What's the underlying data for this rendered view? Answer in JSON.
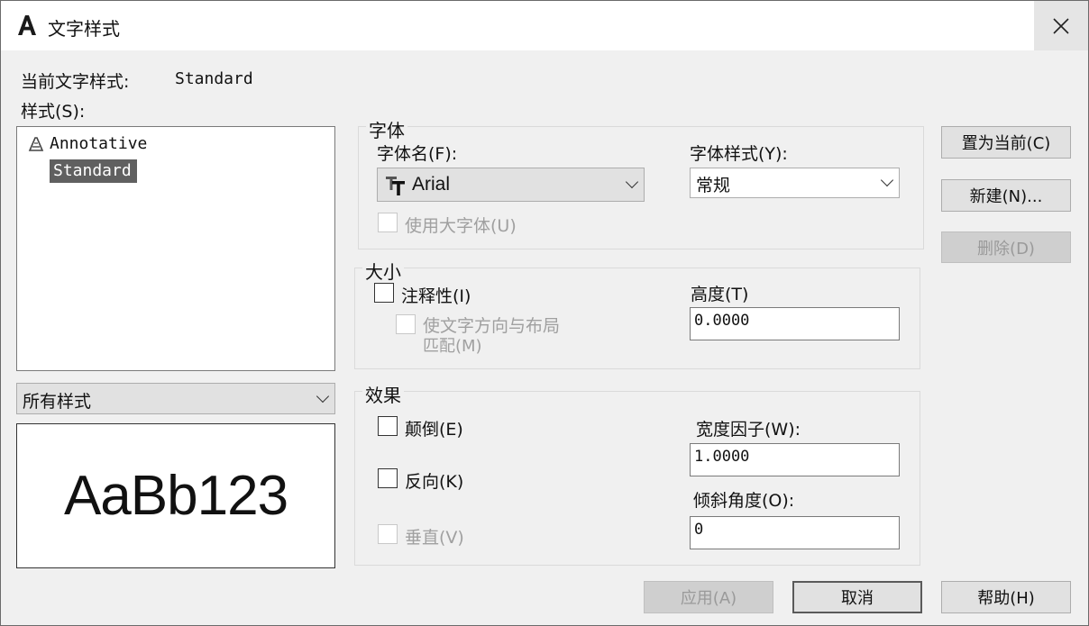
{
  "window": {
    "title": "文字样式",
    "close_symbol": "✕"
  },
  "current_style": {
    "label": "当前文字样式:",
    "value": "Standard"
  },
  "styles": {
    "label": "样式(S):",
    "items": [
      {
        "name": "Annotative",
        "annotative": true
      },
      {
        "name": "Standard",
        "selected": true
      }
    ],
    "filter": "所有样式"
  },
  "preview": {
    "text": "AaBb123"
  },
  "font_group": {
    "legend": "字体",
    "font_name_label": "字体名(F):",
    "font_name_value": "Arial",
    "font_style_label": "字体样式(Y):",
    "font_style_value": "常规",
    "big_font_label": "使用大字体(U)"
  },
  "size_group": {
    "legend": "大小",
    "annotative_label": "注释性(I)",
    "match_orientation_label_1": "使文字方向与布局",
    "match_orientation_label_2": "匹配(M)",
    "height_label": "高度(T)",
    "height_value": "0.0000"
  },
  "effects_group": {
    "legend": "效果",
    "upside_down_label": "颠倒(E)",
    "backwards_label": "反向(K)",
    "vertical_label": "垂直(V)",
    "width_factor_label": "宽度因子(W):",
    "width_factor_value": "1.0000",
    "oblique_angle_label": "倾斜角度(O):",
    "oblique_angle_value": "0"
  },
  "buttons": {
    "set_current": "置为当前(C)",
    "new": "新建(N)...",
    "delete": "删除(D)",
    "apply": "应用(A)",
    "cancel": "取消",
    "help": "帮助(H)"
  },
  "colors": {
    "selection_bg": "#606060",
    "dialog_bg": "#f0f0f0"
  }
}
